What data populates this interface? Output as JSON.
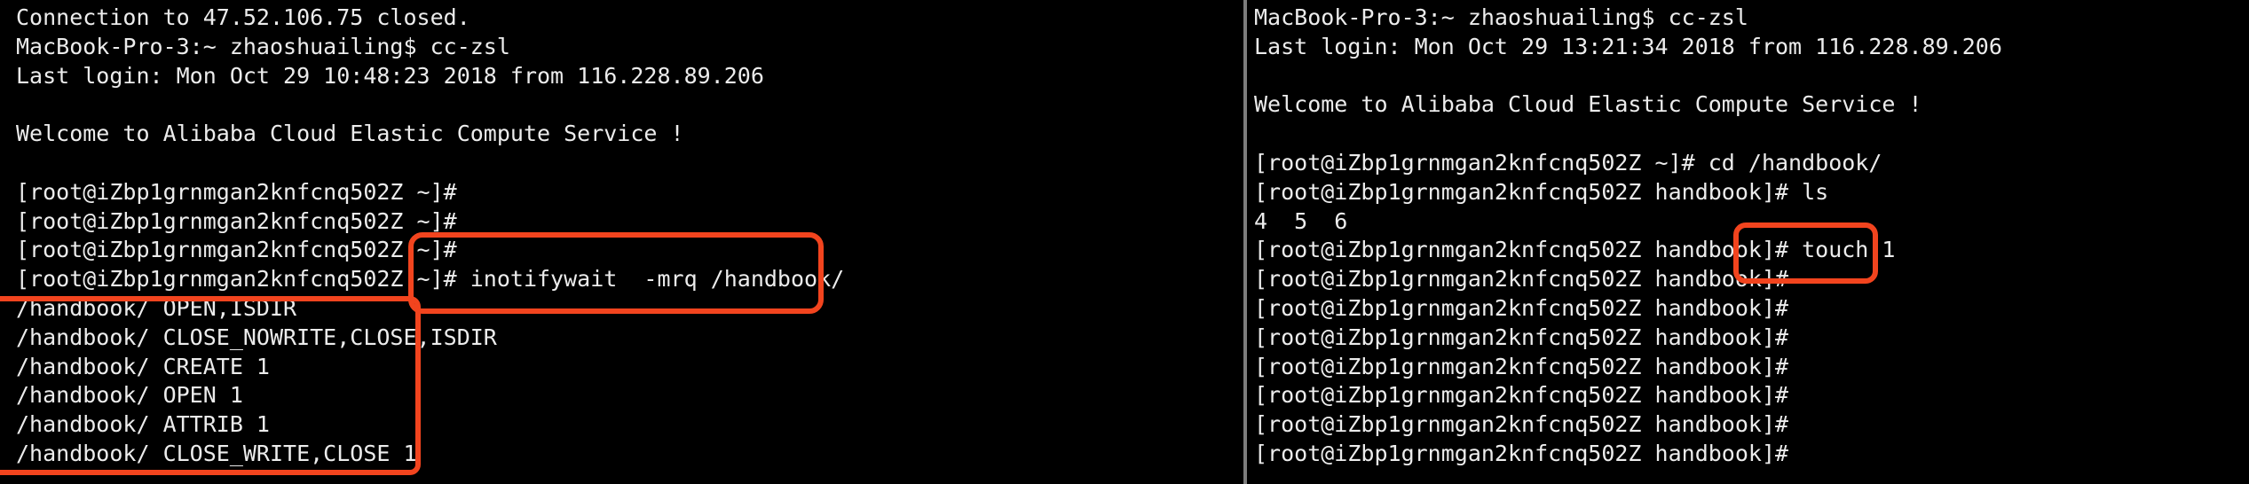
{
  "left_terminal": {
    "lines": [
      "Connection to 47.52.106.75 closed.",
      "MacBook-Pro-3:~ zhaoshuailing$ cc-zsl",
      "Last login: Mon Oct 29 10:48:23 2018 from 116.228.89.206",
      "",
      "Welcome to Alibaba Cloud Elastic Compute Service !",
      "",
      "[root@iZbp1grnmgan2knfcnq502Z ~]#",
      "[root@iZbp1grnmgan2knfcnq502Z ~]#",
      "[root@iZbp1grnmgan2knfcnq502Z ~]#",
      "[root@iZbp1grnmgan2knfcnq502Z ~]# inotifywait  -mrq /handbook/",
      "/handbook/ OPEN,ISDIR",
      "/handbook/ CLOSE_NOWRITE,CLOSE,ISDIR",
      "/handbook/ CREATE 1",
      "/handbook/ OPEN 1",
      "/handbook/ ATTRIB 1",
      "/handbook/ CLOSE_WRITE,CLOSE 1"
    ]
  },
  "right_terminal": {
    "lines": [
      "MacBook-Pro-3:~ zhaoshuailing$ cc-zsl",
      "Last login: Mon Oct 29 13:21:34 2018 from 116.228.89.206",
      "",
      "Welcome to Alibaba Cloud Elastic Compute Service !",
      "",
      "[root@iZbp1grnmgan2knfcnq502Z ~]# cd /handbook/",
      "[root@iZbp1grnmgan2knfcnq502Z handbook]# ls",
      "4  5  6",
      "[root@iZbp1grnmgan2knfcnq502Z handbook]# touch 1",
      "[root@iZbp1grnmgan2knfcnq502Z handbook]#",
      "[root@iZbp1grnmgan2knfcnq502Z handbook]#",
      "[root@iZbp1grnmgan2knfcnq502Z handbook]#",
      "[root@iZbp1grnmgan2knfcnq502Z handbook]#",
      "[root@iZbp1grnmgan2knfcnq502Z handbook]#",
      "[root@iZbp1grnmgan2knfcnq502Z handbook]#",
      "[root@iZbp1grnmgan2knfcnq502Z handbook]#"
    ]
  },
  "colors": {
    "background": "#000000",
    "text": "#ececec",
    "highlight": "#f2441e",
    "divider": "#7d7d7d"
  }
}
